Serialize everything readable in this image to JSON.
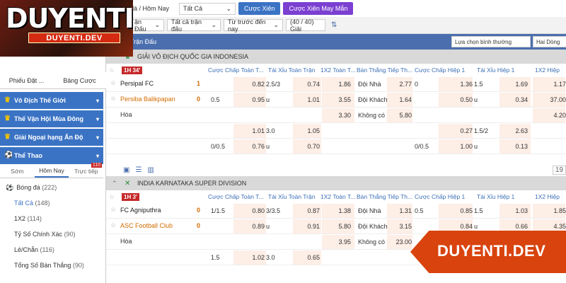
{
  "topbar": {
    "date_label": "đá / Hôm Nay",
    "filter_value": "Tất Cả",
    "parlay_btn": "Cược Xiên",
    "lucky_parlay_btn": "Cược Xiên May Mắn"
  },
  "filterbar": {
    "sel1": "ận Đấu",
    "sel2": "Tất cả trận đấu",
    "sel3": "Từ trước đến nay",
    "count": "(40 / 40) Giải"
  },
  "colbar": {
    "label": "Trận Đấu",
    "display_select": "Lựa chọn bình thường",
    "view_select": "Hai Dòng"
  },
  "headers": {
    "hcap_ft": "Cược Chấp Toàn T...",
    "ou_ft": "Tài Xỉu Toàn Trận",
    "x12_ft": "1X2 Toàn T...",
    "next_goal_ft": "Bàn Thắng Tiếp Th...",
    "hcap_h1": "Cược Chấp Hiệp 1",
    "ou_h1": "Tài Xỉu Hiệp 1",
    "x12_h1": "1X2 Hiệp"
  },
  "leagues": [
    {
      "name": "GIẢI VÔ ĐỊCH QUỐC GIA INDONESIA",
      "time": "1H 34'",
      "home": "Persipal FC",
      "away": "Persiba Balikpapan",
      "home_score": "1",
      "away_score": "0",
      "draw": "Hòa",
      "rows": [
        {
          "hcap_line": "",
          "hcap_odd": "0.82",
          "ou_line": "2.5/3",
          "ou_odd": "0.74",
          "x12": "1.86",
          "ng_label": "Đội Nhà",
          "ng_odd": "2.77",
          "h1_hcap_line": "0",
          "h1_hcap_odd": "1.36",
          "h1_ou_line": "1.5",
          "h1_ou_odd": "1.69",
          "h1_x12": "1.17"
        },
        {
          "hcap_line": "0.5",
          "hcap_odd": "0.95",
          "ou_line": "u",
          "ou_odd": "1.01",
          "x12": "3.55",
          "ng_label": "Đội Khách",
          "ng_odd": "1.64",
          "h1_hcap_line": "",
          "h1_hcap_odd": "0.50",
          "h1_ou_line": "u",
          "h1_ou_odd": "0.34",
          "h1_x12": "37.00"
        },
        {
          "hcap_line": "",
          "hcap_odd": "",
          "ou_line": "",
          "ou_odd": "",
          "x12": "3.30",
          "ng_label": "Không có",
          "ng_odd": "5.80",
          "h1_hcap_line": "",
          "h1_hcap_odd": "",
          "h1_ou_line": "",
          "h1_ou_odd": "",
          "h1_x12": "4.20"
        },
        {
          "hcap_line": "",
          "hcap_odd": "1.01",
          "ou_line": "3.0",
          "ou_odd": "1.05",
          "x12": "",
          "ng_label": "",
          "ng_odd": "",
          "h1_hcap_line": "",
          "h1_hcap_odd": "0.27",
          "h1_ou_line": "1.5/2",
          "h1_ou_odd": "2.63",
          "h1_x12": ""
        },
        {
          "hcap_line": "0/0.5",
          "hcap_odd": "0.76",
          "ou_line": "u",
          "ou_odd": "0.70",
          "x12": "",
          "ng_label": "",
          "ng_odd": "",
          "h1_hcap_line": "0/0.5",
          "h1_hcap_odd": "1.00",
          "h1_ou_line": "u",
          "h1_ou_odd": "0.13",
          "h1_x12": ""
        }
      ],
      "more_count": "19"
    },
    {
      "name": "INDIA KARNATAKA SUPER DIVISION",
      "time": "1H 3'",
      "home": "FC Agniputhra",
      "away": "ASC Football Club",
      "home_score": "0",
      "away_score": "0",
      "draw": "Hòa",
      "rows": [
        {
          "hcap_line": "1/1.5",
          "hcap_odd": "0.80",
          "ou_line": "3/3.5",
          "ou_odd": "0.87",
          "x12": "1.38",
          "ng_label": "Đội Nhà",
          "ng_odd": "1.31",
          "h1_hcap_line": "0.5",
          "h1_hcap_odd": "0.85",
          "h1_ou_line": "1.5",
          "h1_ou_odd": "1.03",
          "h1_x12": "1.85"
        },
        {
          "hcap_line": "",
          "hcap_odd": "0.89",
          "ou_line": "u",
          "ou_odd": "0.91",
          "x12": "5.80",
          "ng_label": "Đội Khách",
          "ng_odd": "3.15",
          "h1_hcap_line": "",
          "h1_hcap_odd": "0.84",
          "h1_ou_line": "u",
          "h1_ou_odd": "0.66",
          "h1_x12": "4.35"
        },
        {
          "hcap_line": "",
          "hcap_odd": "",
          "ou_line": "",
          "ou_odd": "",
          "x12": "3.95",
          "ng_label": "Không có",
          "ng_odd": "23.00",
          "h1_hcap_line": "",
          "h1_hcap_odd": "",
          "h1_ou_line": "",
          "h1_ou_odd": "",
          "h1_x12": ""
        },
        {
          "hcap_line": "1.5",
          "hcap_odd": "1.02",
          "ou_line": "3.0",
          "ou_odd": "0.65",
          "x12": "",
          "ng_label": "",
          "ng_odd": "",
          "h1_hcap_line": "",
          "h1_hcap_odd": "",
          "h1_ou_line": "",
          "h1_ou_odd": "",
          "h1_x12": ""
        }
      ]
    }
  ],
  "sidebar": {
    "tab1": "Phiếu Đặt ...",
    "tab2": "Bảng Cược",
    "groups": [
      "Vô Địch Thế Giới",
      "Thế Vận Hội Mùa Đông",
      "Giải Ngoại hạng Ấn Độ",
      "Thể Thao"
    ],
    "subtabs": [
      "Sớm",
      "Hôm Nay",
      "Trực tiếp"
    ],
    "live_count": "110",
    "sport": "Bóng đá",
    "sport_count": "(222)",
    "items": [
      {
        "label": "Tất Cả",
        "count": "(148)"
      },
      {
        "label": "1X2",
        "count": "(114)"
      },
      {
        "label": "Tỷ Số Chính Xác",
        "count": "(90)"
      },
      {
        "label": "Lẻ/Chẵn",
        "count": "(116)"
      },
      {
        "label": "Tổng Số Bàn Thắng",
        "count": "(90)"
      }
    ]
  },
  "logo": {
    "word": "DUYENTI",
    "sub": "DUYENTI.DEV"
  },
  "watermark": "DUYENTI.DEV",
  "colors": {
    "accent": "#3b73c4",
    "header": "#4b6fae",
    "odds_bg": "#fdeee6",
    "live": "#c62828",
    "brand": "#d9430e"
  }
}
